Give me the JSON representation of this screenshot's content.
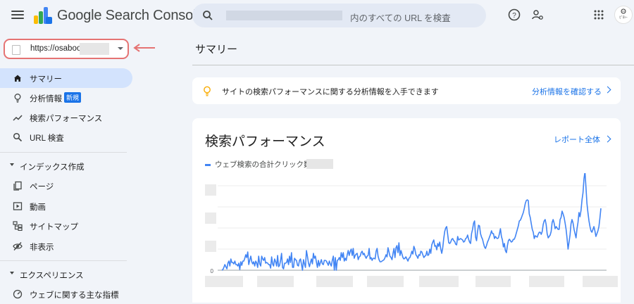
{
  "header": {
    "brand": "Google Search Console",
    "search_suffix": "内のすべての URL を検査",
    "avatar_text": "ﾋﾟﾛｼｰﾎﾟﾝ"
  },
  "property": {
    "url": "https://osaboo"
  },
  "sidebar": {
    "items": [
      {
        "label": "サマリー",
        "icon": "home-icon",
        "active": true
      },
      {
        "label": "分析情報",
        "icon": "lightbulb-icon",
        "badge": "新規"
      },
      {
        "label": "検索パフォーマンス",
        "icon": "trending-icon"
      },
      {
        "label": "URL 検査",
        "icon": "search-icon"
      }
    ],
    "sections": [
      {
        "label": "インデックス作成",
        "items": [
          {
            "label": "ページ",
            "icon": "pages-icon"
          },
          {
            "label": "動画",
            "icon": "video-icon"
          },
          {
            "label": "サイトマップ",
            "icon": "sitemap-icon"
          },
          {
            "label": "非表示",
            "icon": "eye-off-icon"
          }
        ]
      },
      {
        "label": "エクスペリエンス",
        "items": [
          {
            "label": "ウェブに関する主な指標",
            "icon": "gauge-icon"
          }
        ]
      }
    ]
  },
  "main": {
    "title": "サマリー",
    "insight": {
      "text": "サイトの検索パフォーマンスに関する分析情報を入手できます",
      "link": "分析情報を確認する"
    },
    "performance": {
      "title": "検索パフォーマンス",
      "report_link": "レポート全体",
      "legend": "ウェブ検索の合計クリック数:"
    }
  },
  "colors": {
    "accent": "#1a73e8",
    "series": "#4285f4",
    "arrow": "#e57373"
  },
  "chart_data": {
    "type": "line",
    "series": [
      {
        "name": "ウェブ検索の合計クリック数",
        "values": [
          0,
          1,
          4,
          8,
          5,
          2,
          10,
          13,
          6,
          16,
          11,
          11,
          9,
          13,
          8,
          8,
          6,
          10,
          1,
          12,
          7,
          13,
          13,
          17,
          22,
          18,
          26,
          8,
          14,
          20,
          12,
          9,
          12,
          6,
          13,
          10,
          4,
          20,
          9,
          6,
          20,
          16,
          14,
          18,
          10,
          11,
          10,
          8,
          8,
          3,
          19,
          9,
          6,
          16,
          12,
          6,
          21,
          5,
          7,
          14,
          24,
          4,
          2,
          10,
          10,
          11,
          16,
          8,
          20,
          11,
          25,
          4,
          4,
          17,
          15,
          14,
          7,
          6,
          14,
          16,
          8,
          0,
          15,
          9,
          4,
          28,
          20,
          10,
          5,
          11,
          16,
          9,
          24,
          17,
          20,
          12,
          4,
          14,
          6,
          11,
          15,
          9,
          8,
          14,
          14,
          13,
          10,
          7,
          13,
          9,
          6,
          14,
          20,
          0,
          18,
          0,
          14,
          15,
          18,
          14,
          25,
          18,
          25,
          13,
          17,
          14,
          22,
          28,
          21,
          27,
          30,
          21,
          31,
          17,
          21,
          23,
          24,
          15,
          19,
          20,
          25,
          27,
          22,
          24,
          20,
          17,
          20,
          21,
          31,
          16,
          18,
          14,
          17,
          17,
          16,
          27,
          31,
          20,
          15,
          12,
          12,
          13,
          14,
          15,
          18,
          22,
          19,
          32,
          26,
          20,
          18,
          15,
          24,
          31,
          18,
          32,
          35,
          25,
          39,
          21,
          28,
          23,
          18,
          16,
          17,
          19,
          16,
          13,
          17,
          18,
          22,
          27,
          23,
          34,
          30,
          22,
          20,
          17,
          22,
          21,
          27,
          26,
          22,
          18,
          20,
          21,
          27,
          21,
          22,
          30,
          24,
          36,
          40,
          43,
          34,
          35,
          29,
          38,
          34,
          40,
          30,
          24,
          32,
          45,
          55,
          60,
          62,
          51,
          39,
          38,
          40,
          44,
          45,
          42,
          41,
          37,
          36,
          48,
          43,
          44,
          45,
          44,
          43,
          40,
          41,
          45,
          46,
          50,
          44,
          40,
          38,
          52,
          58,
          67,
          70,
          47,
          42,
          55,
          64,
          63,
          52,
          47,
          44,
          38,
          33,
          31,
          35,
          40,
          43,
          47,
          51,
          56,
          52,
          52,
          45,
          48,
          46,
          45,
          46,
          52,
          59,
          48,
          43,
          33,
          38,
          28,
          25,
          35,
          42,
          44,
          42,
          40,
          41,
          44,
          44,
          48,
          53,
          58,
          63,
          70,
          71,
          74,
          78,
          82,
          88,
          95,
          99,
          100,
          99,
          80,
          75,
          66,
          58,
          54,
          45,
          49,
          48,
          47,
          51,
          54,
          54,
          51,
          55,
          65,
          70,
          72,
          65,
          52,
          46,
          48,
          50,
          55,
          68,
          72,
          67,
          59,
          62,
          60,
          58,
          58,
          72,
          75,
          84,
          80,
          75,
          67,
          58,
          45,
          30,
          40,
          50,
          66,
          72,
          67,
          58,
          52,
          46,
          59,
          68,
          82,
          76,
          85,
          100,
          110,
          130,
          140,
          118,
          95,
          82,
          70,
          62,
          56,
          54,
          58,
          62,
          56,
          48,
          52,
          56,
          62,
          74,
          88
        ]
      }
    ],
    "ylim": [
      0,
      120
    ],
    "y_tick_labels": [
      "0"
    ],
    "grid": true
  }
}
